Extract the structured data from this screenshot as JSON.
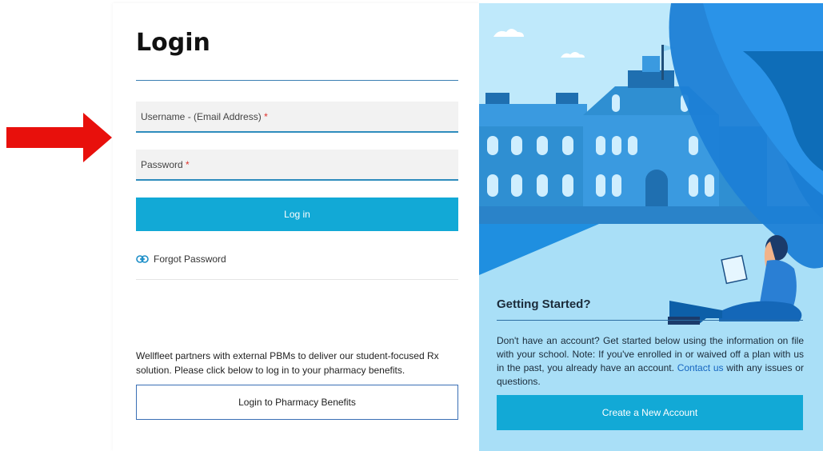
{
  "login": {
    "title": "Login",
    "username_placeholder": "Username - (Email Address)",
    "password_placeholder": "Password",
    "required_mark": "*",
    "login_button": "Log in",
    "forgot_password": "Forgot Password",
    "partner_text": "Wellfleet partners with external PBMs to deliver our student-focused Rx solution. Please click below to log in to your pharmacy benefits.",
    "pharmacy_button": "Login to Pharmacy Benefits"
  },
  "getting_started": {
    "title": "Getting Started?",
    "text_before_link": "Don't have an account? Get started below using the information on file with your school. Note: If you've enrolled in or waived off a plan with us in the past, you already have an account. ",
    "link_text": "Contact us",
    "text_after_link": " with any issues or questions.",
    "create_button": "Create a New Account"
  },
  "colors": {
    "accent": "#12a9d6",
    "arrow": "#e8100c",
    "panel_bg": "#a9dff7",
    "required": "#e0312b",
    "link": "#1565c0"
  },
  "icons": {
    "arrow": "red-arrow-icon",
    "forgot": "link-icon"
  }
}
